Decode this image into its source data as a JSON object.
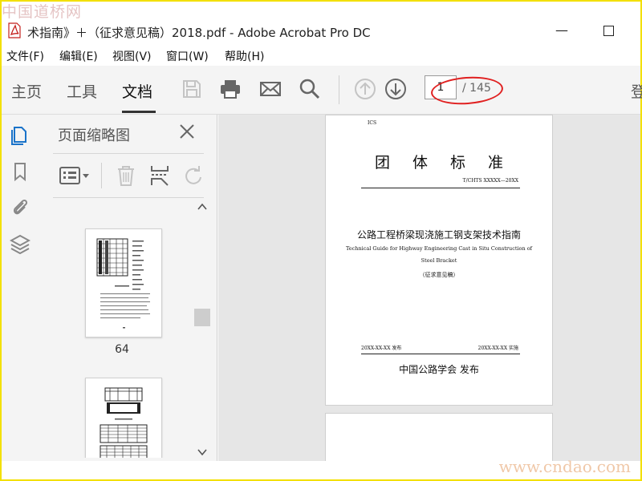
{
  "watermark": {
    "top": "中国道桥网",
    "bottom": "www.cndao.com"
  },
  "window": {
    "title": "术指南》＋（征求意见稿）2018.pdf - Adobe Acrobat Pro DC"
  },
  "menu": {
    "items": [
      "文件(F)",
      "编辑(E)",
      "视图(V)",
      "窗口(W)",
      "帮助(H)"
    ]
  },
  "toolbar": {
    "tabs": [
      {
        "label": "主页",
        "active": false
      },
      {
        "label": "工具",
        "active": false
      },
      {
        "label": "文档",
        "active": true
      }
    ],
    "current_page": "1",
    "total_pages": "/ 145",
    "overflow_label": "登"
  },
  "thumbnails_panel": {
    "title": "页面缩略图",
    "pages": [
      {
        "label": "64"
      }
    ]
  },
  "document": {
    "header_small": "ICS",
    "title": "团体标准",
    "code": "T/CHTS XXXXX—20XX",
    "cn_name": "公路工程桥梁现浇施工钢支架技术指南",
    "en_name_line1": "Technical Guide for Highway Engineering Cast in Situ Construction of",
    "en_name_line2": "Steel Bracket",
    "draft_note": "（征求意见稿）",
    "issue_date": "20XX-XX-XX 发布",
    "impl_date": "20XX-XX-XX 实施",
    "publisher": "中国公路学会  发布"
  },
  "colors": {
    "accent_blue": "#1a73c9",
    "annotation_red": "#e02020",
    "frame_yellow": "#f3e000"
  }
}
